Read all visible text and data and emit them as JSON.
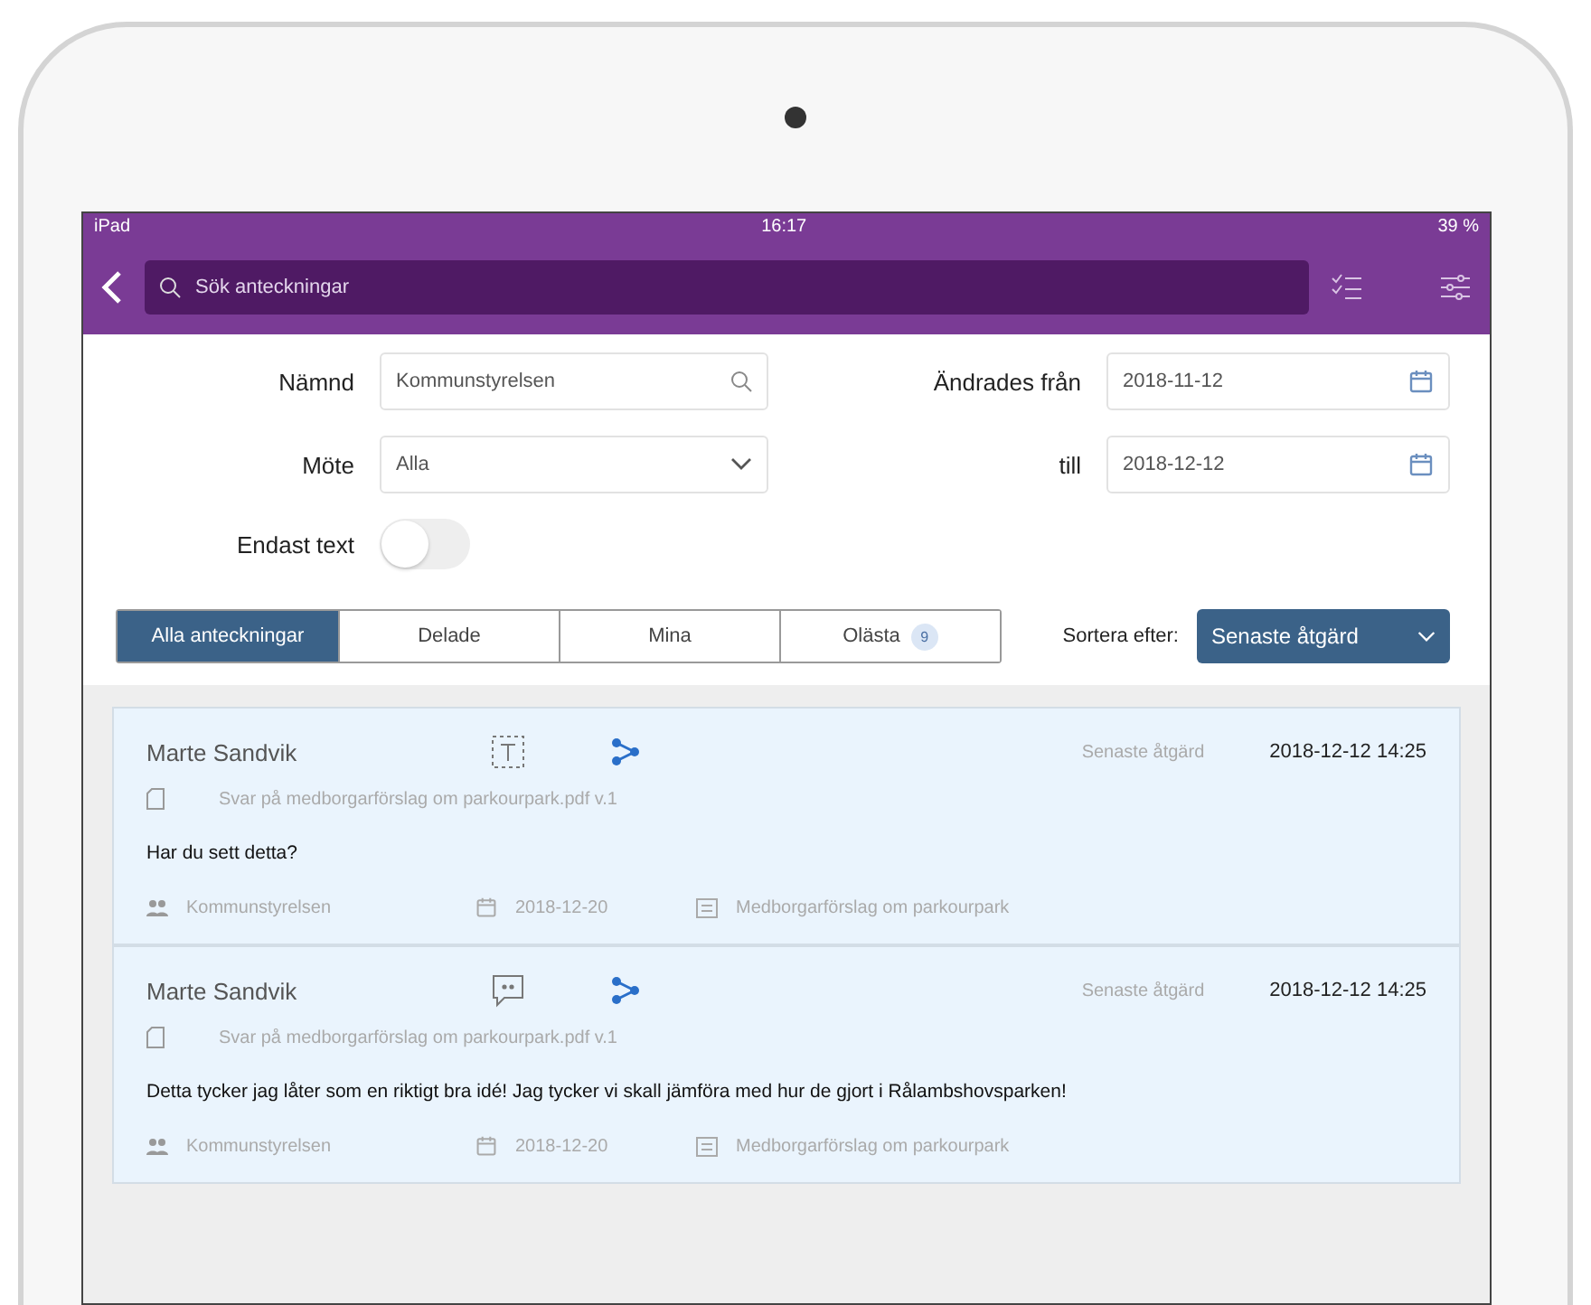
{
  "status_bar": {
    "device": "iPad",
    "time": "16:17",
    "battery": "39 %"
  },
  "search": {
    "placeholder": "Sök anteckningar"
  },
  "filters": {
    "committee": {
      "label": "Nämnd",
      "value": "Kommunstyrelsen"
    },
    "meeting": {
      "label": "Möte",
      "value": "Alla"
    },
    "only_text": {
      "label": "Endast text",
      "on": false
    },
    "changed_from": {
      "label": "Ändrades från",
      "value": "2018-11-12"
    },
    "changed_to": {
      "label": "till",
      "value": "2018-12-12"
    }
  },
  "tabs": [
    {
      "label": "Alla anteckningar",
      "selected": true
    },
    {
      "label": "Delade",
      "selected": false
    },
    {
      "label": "Mina",
      "selected": false
    },
    {
      "label": "Olästa",
      "badge": "9",
      "selected": false
    }
  ],
  "sort": {
    "label": "Sortera efter:",
    "value": "Senaste åtgärd"
  },
  "notes": [
    {
      "author": "Marte Sandvik",
      "kind": "text",
      "action_label": "Senaste åtgärd",
      "timestamp": "2018-12-12 14:25",
      "document": "Svar på medborgarförslag om parkourpark.pdf v.1",
      "text": "Har du sett detta?",
      "committee": "Kommunstyrelsen",
      "date": "2018-12-20",
      "meeting": "Medborgarförslag om parkourpark"
    },
    {
      "author": "Marte Sandvik",
      "kind": "comment",
      "action_label": "Senaste åtgärd",
      "timestamp": "2018-12-12 14:25",
      "document": "Svar på medborgarförslag om parkourpark.pdf v.1",
      "text": "Detta tycker jag låter som en riktigt bra idé! Jag tycker vi skall jämföra med hur de gjort i Rålambshovsparken!",
      "committee": "Kommunstyrelsen",
      "date": "2018-12-20",
      "meeting": "Medborgarförslag om parkourpark"
    }
  ]
}
